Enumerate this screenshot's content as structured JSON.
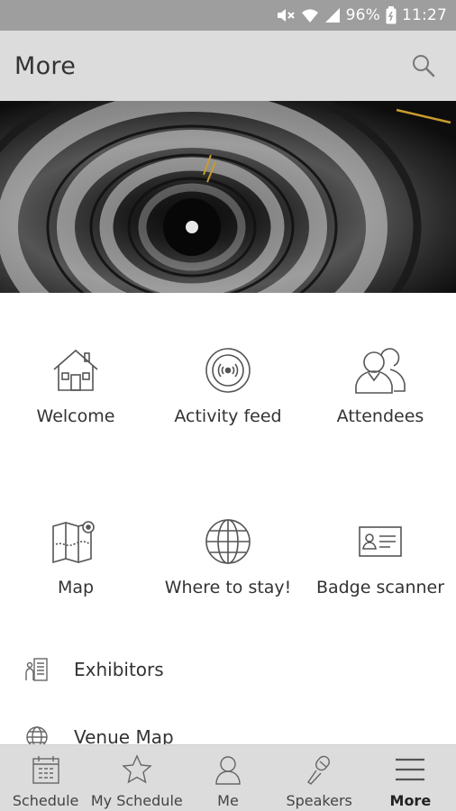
{
  "status_bar": {
    "battery": "96%",
    "time": "11:27"
  },
  "app_bar": {
    "title": "More"
  },
  "tiles": [
    {
      "label": "Welcome",
      "icon": "home-icon"
    },
    {
      "label": "Activity feed",
      "icon": "activity-feed-icon"
    },
    {
      "label": "Attendees",
      "icon": "attendees-icon"
    },
    {
      "label": "Map",
      "icon": "map-icon"
    },
    {
      "label": "Where to stay!",
      "icon": "globe-icon"
    },
    {
      "label": "Badge scanner",
      "icon": "badge-icon"
    }
  ],
  "list": [
    {
      "label": "Exhibitors",
      "icon": "exhibitors-icon"
    },
    {
      "label": "Venue Map",
      "icon": "globe-icon"
    }
  ],
  "bottom_nav": [
    {
      "label": "Schedule",
      "icon": "calendar-icon"
    },
    {
      "label": "My Schedule",
      "icon": "star-icon"
    },
    {
      "label": "Me",
      "icon": "person-icon"
    },
    {
      "label": "Speakers",
      "icon": "microphone-icon"
    },
    {
      "label": "More",
      "icon": "menu-icon",
      "active": true
    }
  ],
  "colors": {
    "status_bar": "#9e9e9e",
    "app_bar": "#dcdcdc",
    "bottom_nav": "#dcdcdc",
    "icon_stroke": "#555555"
  }
}
